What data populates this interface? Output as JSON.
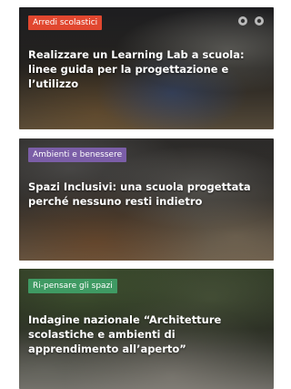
{
  "cards": [
    {
      "category": "Arredi scolastici",
      "category_color": "#e1472f",
      "title": "Realizzare un Learning Lab a scuola: linee guida per la progettazione e l’utilizzo"
    },
    {
      "category": "Ambienti e benessere",
      "category_color": "#7b5ea7",
      "title": "Spazi Inclusivi: una scuola progettata perché nessuno resti indietro"
    },
    {
      "category": "Ri-pensare gli spazi",
      "category_color": "#3f9a63",
      "title": "Indagine nazionale “Architetture scolastiche e ambienti di apprendimento all’aperto”"
    }
  ]
}
